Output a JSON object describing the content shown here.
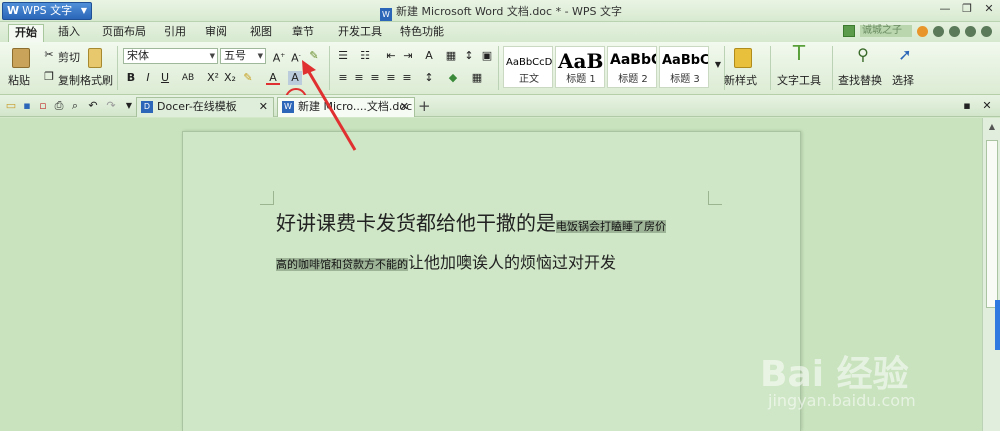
{
  "titlebar": {
    "app_name": "WPS 文字",
    "window_title": "新建 Microsoft Word 文档.doc * - WPS 文字"
  },
  "menu": {
    "tabs": [
      "开始",
      "插入",
      "页面布局",
      "引用",
      "审阅",
      "视图",
      "章节",
      "开发工具",
      "特色功能"
    ],
    "active_tab": "开始",
    "user_name": "诚城之子"
  },
  "ribbon": {
    "paste": "粘贴",
    "cut": "剪切",
    "copy": "复制",
    "format_painter": "格式刷",
    "font_name": "宋体",
    "font_size": "五号",
    "styles": [
      {
        "sample": "AaBbCcDd",
        "name": "正文"
      },
      {
        "sample": "AaBl",
        "name": "标题 1"
      },
      {
        "sample": "AaBbC",
        "name": "标题 2"
      },
      {
        "sample": "AaBbC",
        "name": "标题 3"
      }
    ],
    "new_style": "新样式",
    "text_tools": "文字工具",
    "find_replace": "查找替换",
    "select": "选择"
  },
  "doc_tabs": [
    {
      "label": "Docer-在线模板",
      "active": false
    },
    {
      "label": "新建 Micro....文档.doc *",
      "active": true
    }
  ],
  "document": {
    "line1_big": "好讲课费卡发货都给他干撒的是",
    "line1_hl": "电饭锅会打瞌睡了房价",
    "line2_hl": "高的咖啡馆和贷款方不能的",
    "line2_big": "让他加噢诶人的烦恼过对开发"
  },
  "watermark": {
    "brand": "Bai 经验",
    "url": "jingyan.baidu.com"
  },
  "colors": {
    "accent": "#2b66b8",
    "annotation": "#e03030",
    "highlight": "#9eb497"
  }
}
